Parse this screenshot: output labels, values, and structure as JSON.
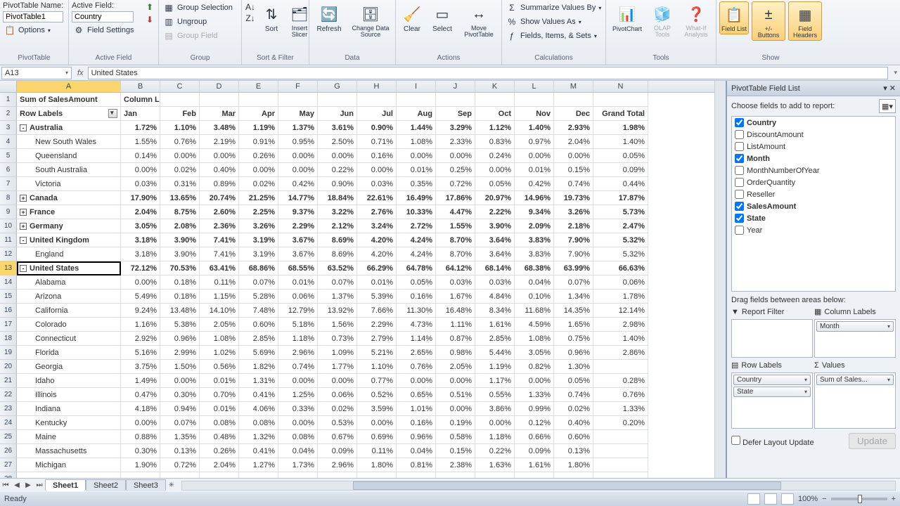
{
  "ribbon": {
    "pivot_name_label": "PivotTable Name:",
    "pivot_name_value": "PivotTable1",
    "options_label": "Options",
    "active_field_label": "Active Field:",
    "active_field_value": "Country",
    "field_settings": "Field Settings",
    "group_selection": "Group Selection",
    "ungroup": "Ungroup",
    "group_field": "Group Field",
    "sort": "Sort",
    "insert_slicer": "Insert Slicer",
    "refresh": "Refresh",
    "change_data": "Change Data Source",
    "clear": "Clear",
    "select": "Select",
    "move": "Move PivotTable",
    "summarize": "Summarize Values By",
    "show_as": "Show Values As",
    "fields_items": "Fields, Items, & Sets",
    "pivot_chart": "PivotChart",
    "olap": "OLAP Tools",
    "whatif": "What-If Analysis",
    "field_list": "Field List",
    "buttons": "+/- Buttons",
    "headers": "Field Headers",
    "groups": {
      "pivottable": "PivotTable",
      "active_field": "Active Field",
      "group": "Group",
      "sort_filter": "Sort & Filter",
      "data": "Data",
      "actions": "Actions",
      "calculations": "Calculations",
      "tools": "Tools",
      "show": "Show"
    }
  },
  "formula": {
    "cell_ref": "A13",
    "value": "United States"
  },
  "columns": [
    "A",
    "B",
    "C",
    "D",
    "E",
    "F",
    "G",
    "H",
    "I",
    "J",
    "K",
    "L",
    "M",
    "N"
  ],
  "grid": {
    "header_row": [
      "Sum of SalesAmount",
      "Column Labels"
    ],
    "month_row": [
      "Row Labels",
      "Jan",
      "Feb",
      "Mar",
      "Apr",
      "May",
      "Jun",
      "Jul",
      "Aug",
      "Sep",
      "Oct",
      "Nov",
      "Dec",
      "Grand Total"
    ],
    "rows": [
      {
        "n": 3,
        "label": "Australia",
        "bold": true,
        "exp": "-",
        "v": [
          "1.72%",
          "1.10%",
          "3.48%",
          "1.19%",
          "1.37%",
          "3.61%",
          "0.90%",
          "1.44%",
          "3.29%",
          "1.12%",
          "1.40%",
          "2.93%",
          "1.98%"
        ]
      },
      {
        "n": 4,
        "label": "New South Wales",
        "indent": 1,
        "v": [
          "1.55%",
          "0.76%",
          "2.19%",
          "0.91%",
          "0.95%",
          "2.50%",
          "0.71%",
          "1.08%",
          "2.33%",
          "0.83%",
          "0.97%",
          "2.04%",
          "1.40%"
        ]
      },
      {
        "n": 5,
        "label": "Queensland",
        "indent": 1,
        "v": [
          "0.14%",
          "0.00%",
          "0.00%",
          "0.26%",
          "0.00%",
          "0.00%",
          "0.16%",
          "0.00%",
          "0.00%",
          "0.24%",
          "0.00%",
          "0.00%",
          "0.05%"
        ]
      },
      {
        "n": 6,
        "label": "South Australia",
        "indent": 1,
        "v": [
          "0.00%",
          "0.02%",
          "0.40%",
          "0.00%",
          "0.00%",
          "0.22%",
          "0.00%",
          "0.01%",
          "0.25%",
          "0.00%",
          "0.01%",
          "0.15%",
          "0.09%"
        ]
      },
      {
        "n": 7,
        "label": "Victoria",
        "indent": 1,
        "v": [
          "0.03%",
          "0.31%",
          "0.89%",
          "0.02%",
          "0.42%",
          "0.90%",
          "0.03%",
          "0.35%",
          "0.72%",
          "0.05%",
          "0.42%",
          "0.74%",
          "0.44%"
        ]
      },
      {
        "n": 8,
        "label": "Canada",
        "bold": true,
        "exp": "+",
        "v": [
          "17.90%",
          "13.65%",
          "20.74%",
          "21.25%",
          "14.77%",
          "18.84%",
          "22.61%",
          "16.49%",
          "17.86%",
          "20.97%",
          "14.96%",
          "19.73%",
          "17.87%"
        ]
      },
      {
        "n": 9,
        "label": "France",
        "bold": true,
        "exp": "+",
        "v": [
          "2.04%",
          "8.75%",
          "2.60%",
          "2.25%",
          "9.37%",
          "3.22%",
          "2.76%",
          "10.33%",
          "4.47%",
          "2.22%",
          "9.34%",
          "3.26%",
          "5.73%"
        ]
      },
      {
        "n": 10,
        "label": "Germany",
        "bold": true,
        "exp": "+",
        "v": [
          "3.05%",
          "2.08%",
          "2.36%",
          "3.26%",
          "2.29%",
          "2.12%",
          "3.24%",
          "2.72%",
          "1.55%",
          "3.90%",
          "2.09%",
          "2.18%",
          "2.47%"
        ]
      },
      {
        "n": 11,
        "label": "United Kingdom",
        "bold": true,
        "exp": "-",
        "v": [
          "3.18%",
          "3.90%",
          "7.41%",
          "3.19%",
          "3.67%",
          "8.69%",
          "4.20%",
          "4.24%",
          "8.70%",
          "3.64%",
          "3.83%",
          "7.90%",
          "5.32%"
        ]
      },
      {
        "n": 12,
        "label": "England",
        "indent": 1,
        "v": [
          "3.18%",
          "3.90%",
          "7.41%",
          "3.19%",
          "3.67%",
          "8.69%",
          "4.20%",
          "4.24%",
          "8.70%",
          "3.64%",
          "3.83%",
          "7.90%",
          "5.32%"
        ]
      },
      {
        "n": 13,
        "label": "United States",
        "bold": true,
        "exp": "-",
        "sel": true,
        "v": [
          "72.12%",
          "70.53%",
          "63.41%",
          "68.86%",
          "68.55%",
          "63.52%",
          "66.29%",
          "64.78%",
          "64.12%",
          "68.14%",
          "68.38%",
          "63.99%",
          "66.63%"
        ]
      },
      {
        "n": 14,
        "label": "Alabama",
        "indent": 1,
        "v": [
          "0.00%",
          "0.18%",
          "0.11%",
          "0.07%",
          "0.01%",
          "0.07%",
          "0.01%",
          "0.05%",
          "0.03%",
          "0.03%",
          "0.04%",
          "0.07%",
          "0.06%"
        ]
      },
      {
        "n": 15,
        "label": "Arizona",
        "indent": 1,
        "v": [
          "5.49%",
          "0.18%",
          "1.15%",
          "5.28%",
          "0.06%",
          "1.37%",
          "5.39%",
          "0.16%",
          "1.67%",
          "4.84%",
          "0.10%",
          "1.34%",
          "1.78%"
        ]
      },
      {
        "n": 16,
        "label": "California",
        "indent": 1,
        "v": [
          "9.24%",
          "13.48%",
          "14.10%",
          "7.48%",
          "12.79%",
          "13.92%",
          "7.66%",
          "11.30%",
          "16.48%",
          "8.34%",
          "11.68%",
          "14.35%",
          "12.14%"
        ]
      },
      {
        "n": 17,
        "label": "Colorado",
        "indent": 1,
        "v": [
          "1.16%",
          "5.38%",
          "2.05%",
          "0.60%",
          "5.18%",
          "1.56%",
          "2.29%",
          "4.73%",
          "1.11%",
          "1.61%",
          "4.59%",
          "1.65%",
          "2.98%"
        ]
      },
      {
        "n": 18,
        "label": "Connecticut",
        "indent": 1,
        "v": [
          "2.92%",
          "0.96%",
          "1.08%",
          "2.85%",
          "1.18%",
          "0.73%",
          "2.79%",
          "1.14%",
          "0.87%",
          "2.85%",
          "1.08%",
          "0.75%",
          "1.40%"
        ]
      },
      {
        "n": 19,
        "label": "Florida",
        "indent": 1,
        "v": [
          "5.16%",
          "2.99%",
          "1.02%",
          "5.69%",
          "2.96%",
          "1.09%",
          "5.21%",
          "2.65%",
          "0.98%",
          "5.44%",
          "3.05%",
          "0.96%",
          "2.86%"
        ]
      },
      {
        "n": 20,
        "label": "Georgia",
        "indent": 1,
        "v": [
          "3.75%",
          "1.50%",
          "0.56%",
          "1.82%",
          "0.74%",
          "1.77%",
          "1.10%",
          "0.76%",
          "2.05%",
          "1.19%",
          "0.82%",
          "1.30%",
          ""
        ]
      },
      {
        "n": 21,
        "label": "Idaho",
        "indent": 1,
        "v": [
          "1.49%",
          "0.00%",
          "0.01%",
          "1.31%",
          "0.00%",
          "0.00%",
          "0.77%",
          "0.00%",
          "0.00%",
          "1.17%",
          "0.00%",
          "0.05%",
          "0.28%"
        ]
      },
      {
        "n": 22,
        "label": "Illinois",
        "indent": 1,
        "v": [
          "0.47%",
          "0.30%",
          "0.70%",
          "0.41%",
          "1.25%",
          "0.06%",
          "0.52%",
          "0.65%",
          "0.51%",
          "0.55%",
          "1.33%",
          "0.74%",
          "0.76%"
        ]
      },
      {
        "n": 23,
        "label": "Indiana",
        "indent": 1,
        "v": [
          "4.18%",
          "0.94%",
          "0.01%",
          "4.06%",
          "0.33%",
          "0.02%",
          "3.59%",
          "1.01%",
          "0.00%",
          "3.86%",
          "0.99%",
          "0.02%",
          "1.33%"
        ]
      },
      {
        "n": 24,
        "label": "Kentucky",
        "indent": 1,
        "v": [
          "0.00%",
          "0.07%",
          "0.08%",
          "0.08%",
          "0.00%",
          "0.53%",
          "0.00%",
          "0.16%",
          "0.19%",
          "0.00%",
          "0.12%",
          "0.40%",
          "0.20%"
        ]
      },
      {
        "n": 25,
        "label": "Maine",
        "indent": 1,
        "v": [
          "0.88%",
          "1.35%",
          "0.48%",
          "1.32%",
          "0.08%",
          "0.67%",
          "0.69%",
          "0.96%",
          "0.58%",
          "1.18%",
          "0.66%",
          "0.60%",
          ""
        ]
      },
      {
        "n": 26,
        "label": "Massachusetts",
        "indent": 1,
        "v": [
          "0.30%",
          "0.13%",
          "0.26%",
          "0.41%",
          "0.04%",
          "0.09%",
          "0.11%",
          "0.04%",
          "0.15%",
          "0.22%",
          "0.09%",
          "0.13%",
          ""
        ]
      },
      {
        "n": 27,
        "label": "Michigan",
        "indent": 1,
        "v": [
          "1.90%",
          "0.72%",
          "2.04%",
          "1.27%",
          "1.73%",
          "2.96%",
          "1.80%",
          "0.81%",
          "2.38%",
          "1.63%",
          "1.61%",
          "1.80%",
          ""
        ]
      },
      {
        "n": 28,
        "label": "",
        "indent": 1,
        "v": [
          "",
          "",
          "",
          "",
          "",
          "",
          "",
          "",
          "",
          "",
          "",
          "",
          ""
        ]
      }
    ]
  },
  "pane": {
    "title": "PivotTable Field List",
    "choose": "Choose fields to add to report:",
    "fields": [
      {
        "label": "Country",
        "checked": true,
        "bold": true
      },
      {
        "label": "DiscountAmount",
        "checked": false
      },
      {
        "label": "ListAmount",
        "checked": false
      },
      {
        "label": "Month",
        "checked": true,
        "bold": true
      },
      {
        "label": "MonthNumberOfYear",
        "checked": false
      },
      {
        "label": "OrderQuantity",
        "checked": false
      },
      {
        "label": "Reseller",
        "checked": false
      },
      {
        "label": "SalesAmount",
        "checked": true,
        "bold": true
      },
      {
        "label": "State",
        "checked": true,
        "bold": true
      },
      {
        "label": "Year",
        "checked": false
      }
    ],
    "drag": "Drag fields between areas below:",
    "area_labels": {
      "filter": "Report Filter",
      "columns": "Column Labels",
      "rows": "Row Labels",
      "values": "Values"
    },
    "areas": {
      "filter": [],
      "columns": [
        "Month"
      ],
      "rows": [
        "Country",
        "State"
      ],
      "values": [
        "Sum of Sales..."
      ]
    },
    "defer": "Defer Layout Update",
    "update": "Update"
  },
  "sheets": {
    "tabs": [
      "Sheet1",
      "Sheet2",
      "Sheet3"
    ],
    "active": 0
  },
  "status": {
    "ready": "Ready",
    "zoom": "100%"
  }
}
